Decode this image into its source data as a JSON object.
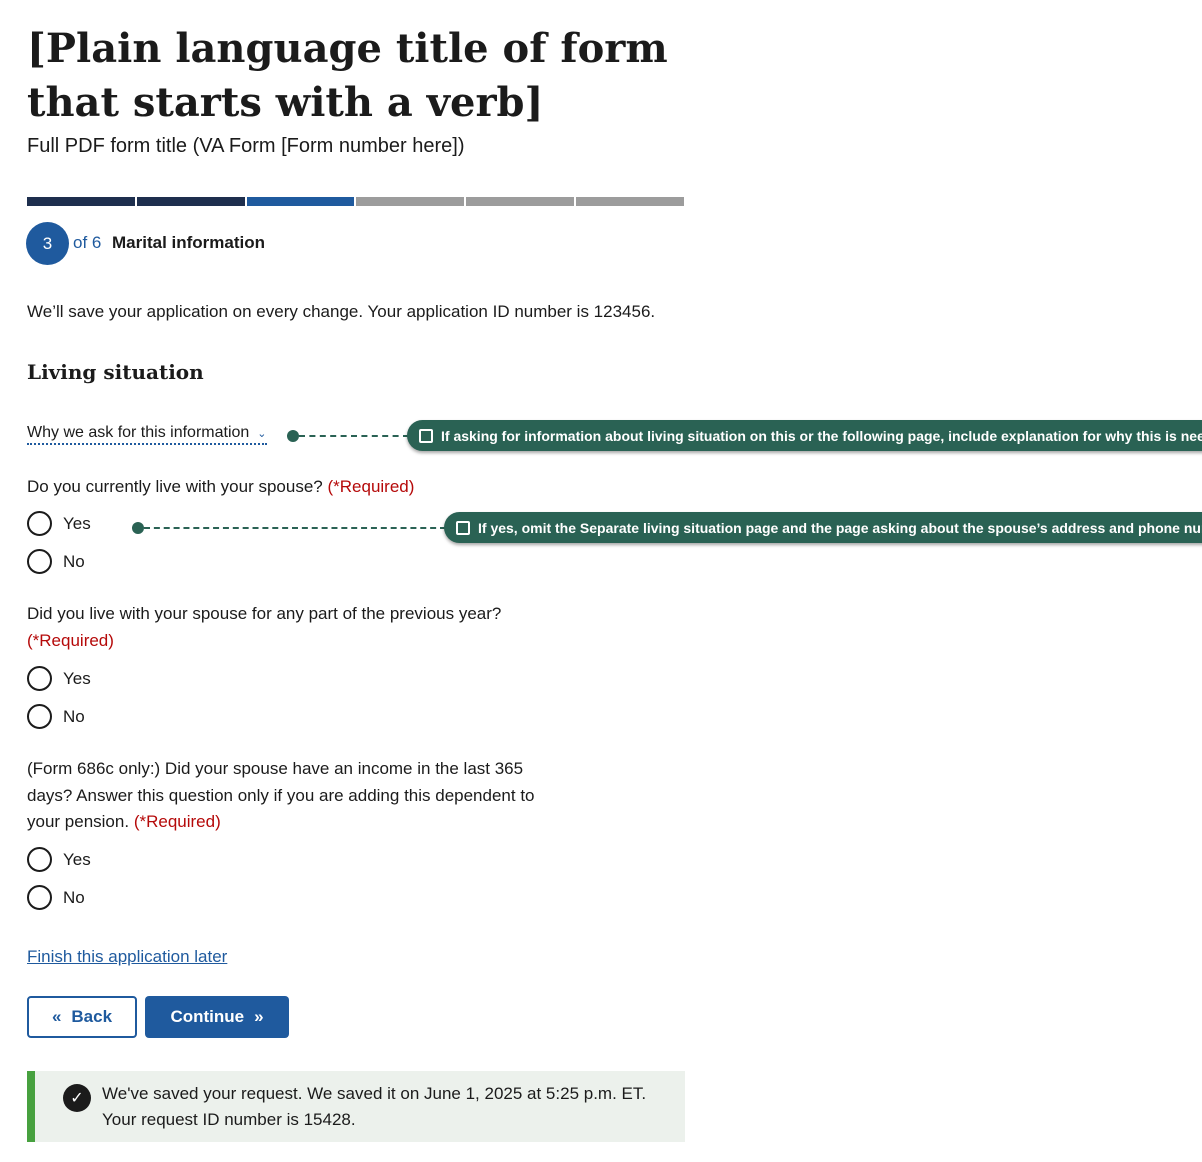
{
  "header": {
    "title": "[Plain language title of form that starts with a verb]",
    "subtitle": "Full PDF form title (VA Form [Form number here])"
  },
  "progress": {
    "current_step": "3",
    "of_total": "of 6",
    "step_name": "Marital information",
    "segments_total": 6,
    "segments_completed": 2,
    "colors": {
      "completed": "#1e2f4e",
      "current": "#1f5a9e",
      "remaining": "#9c9c9c"
    }
  },
  "save_note": "We’ll save your application on every change. Your application ID number is 123456.",
  "section": {
    "title": "Living situation",
    "why_link": "Why we ask for this information"
  },
  "questions": [
    {
      "text": "Do you currently live with your spouse?",
      "required": "(*Required)",
      "options": [
        "Yes",
        "No"
      ]
    },
    {
      "text": "Did you live with your spouse for any part of the previous year?",
      "required": "(*Required)",
      "options": [
        "Yes",
        "No"
      ]
    },
    {
      "text": "(Form 686c only:) Did your spouse have an income in the last 365 days? Answer this question only if you are adding this dependent to your pension.",
      "required": "(*Required)",
      "options": [
        "Yes",
        "No"
      ]
    }
  ],
  "finish_link": "Finish this application later",
  "buttons": {
    "back": "Back",
    "continue": "Continue"
  },
  "alert": {
    "line1": "We've saved your request. We saved it on June 1, 2025 at 5:25 p.m. ET.",
    "line2": "Your request ID number is 15428."
  },
  "annotations": [
    "If asking for information about living situation on this or the following page, include explanation for why this is needed.",
    "If yes, omit the Separate living situation page and the page asking about the spouse’s address and phone number."
  ],
  "colors": {
    "primary": "#1f5a9e",
    "required": "#b50909",
    "success": "#47a13f",
    "annotation": "#2a6254"
  }
}
